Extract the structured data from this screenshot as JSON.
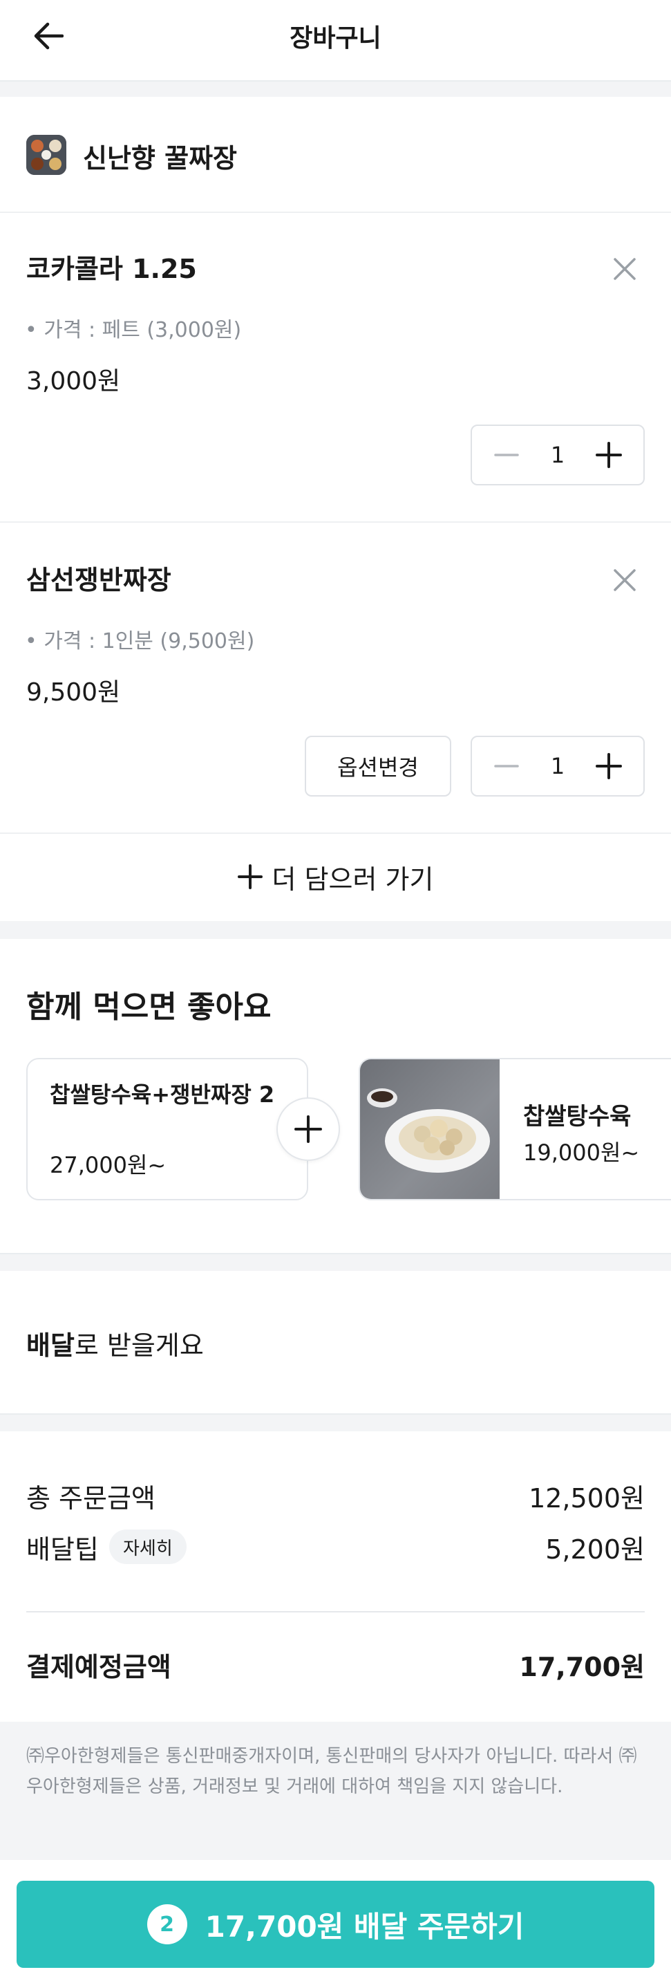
{
  "header": {
    "title": "장바구니",
    "back_icon": "arrow-left-icon"
  },
  "store": {
    "name": "신난향 꿀짜장"
  },
  "items": [
    {
      "name": "코카콜라 1.25",
      "option": "• 가격 : 페트 (3,000원)",
      "price": "3,000원",
      "qty": "1"
    },
    {
      "name": "삼선쟁반짜장",
      "option": "• 가격 : 1인분 (9,500원)",
      "price": "9,500원",
      "qty": "1",
      "option_change_label": "옵션변경"
    }
  ],
  "add_more_label": "더 담으러 가기",
  "recommend": {
    "title": "함께 먹으면 좋아요",
    "cards": [
      {
        "name": "찹쌀탕수육+쟁반짜장 2",
        "price": "27,000원~"
      },
      {
        "name": "찹쌀탕수육",
        "price": "19,000원~"
      }
    ]
  },
  "delivery": {
    "bold": "배달",
    "rest": "로 받을게요"
  },
  "summary": {
    "order_label": "총 주문금액",
    "order_value": "12,500원",
    "tip_label": "배달팁",
    "tip_detail": "자세히",
    "tip_value": "5,200원",
    "total_label": "결제예정금액",
    "total_value": "17,700원"
  },
  "notice": "㈜우아한형제들은 통신판매중개자이며, 통신판매의 당사자가 아닙니다. 따라서 ㈜우아한형제들은 상품, 거래정보 및 거래에 대하여 책임을 지지 않습니다.",
  "order_button": {
    "count": "2",
    "label": "17,700원 배달 주문하기"
  },
  "colors": {
    "accent": "#2ac1bc",
    "background_gray": "#f3f4f6",
    "muted_text": "#8a8f96"
  }
}
